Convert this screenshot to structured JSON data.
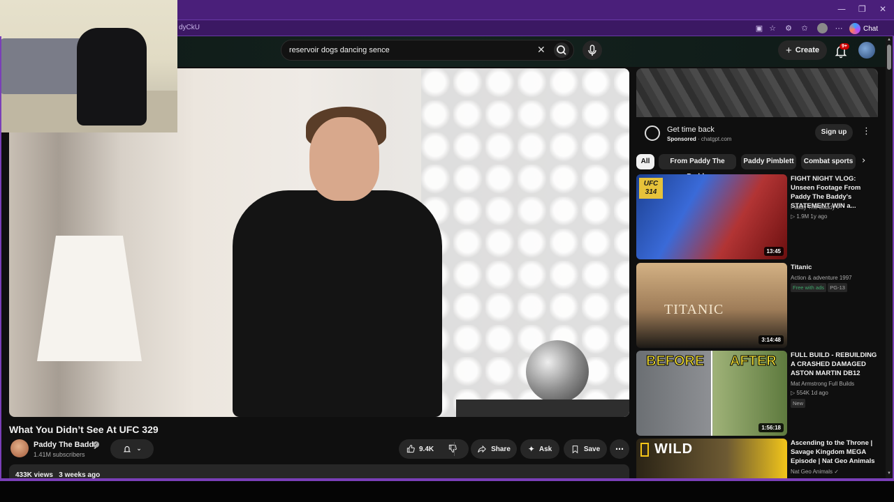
{
  "browser": {
    "url_fragment": "dyCkU",
    "chat_label": "Chat",
    "window_controls": [
      "—",
      "❐",
      "✕"
    ]
  },
  "header": {
    "search_value": "reservoir dogs dancing sence",
    "create_label": "Create",
    "notification_count": "9+"
  },
  "video": {
    "title": "What You Didn’t See At UFC 329",
    "channel_name": "Paddy The Baddy",
    "subscribers": "1.41M subscribers",
    "likes": "9.4K",
    "share_label": "Share",
    "ask_label": "Ask",
    "save_label": "Save",
    "views": "433K views",
    "posted": "3 weeks ago"
  },
  "ad": {
    "title": "Get time back",
    "sponsored": "Sponsored",
    "domain": "chatgpt.com",
    "signup_label": "Sign up"
  },
  "chips": [
    "All",
    "From Paddy The Baddy",
    "Paddy Pimblett",
    "Combat sports"
  ],
  "recommendations": [
    {
      "title": "FIGHT NIGHT VLOG: Unseen Footage From Paddy The Baddy's STATEMENT WIN a...",
      "channel": "Paddy The Baddy",
      "stats": "1.9M   1y ago",
      "duration": "13:45",
      "thumb_badge": "UFC 314"
    },
    {
      "title": "Titanic",
      "channel": "Action & adventure 1997",
      "tag1": "Free with ads",
      "tag2": "PG-13",
      "duration": "3:14:48",
      "thumb_word": "TITANIC"
    },
    {
      "title": "FULL BUILD - REBUILDING A CRASHED DAMAGED ASTON MARTIN DB12",
      "channel": "Mat Armstrong Full Builds",
      "stats": "554K   1d ago",
      "tag1": "New",
      "duration": "1:56:18",
      "thumb_left": "BEFORE",
      "thumb_right": "AFTER"
    },
    {
      "title": "Ascending to the Throne | Savage Kingdom MEGA Episode | Nat Geo Animals",
      "channel": "Nat Geo Animals",
      "thumb_word": "WILD"
    }
  ]
}
